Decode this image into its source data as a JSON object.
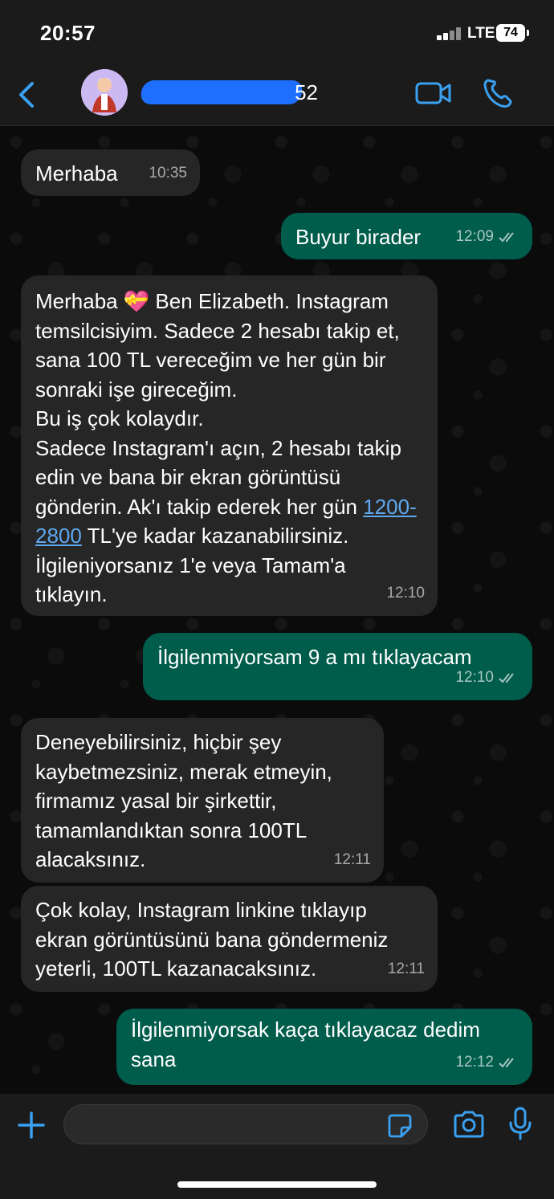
{
  "status_bar": {
    "time": "20:57",
    "network": "LTE",
    "battery": "74"
  },
  "header": {
    "contact_name_visible": "52"
  },
  "messages": [
    {
      "dir": "in",
      "text": "Merhaba",
      "time": "10:35"
    },
    {
      "dir": "out",
      "text": "Buyur birader",
      "time": "12:09"
    },
    {
      "dir": "in",
      "text_before_link": "Merhaba 💝 Ben Elizabeth. Instagram temsilcisiyim. Sadece 2 hesabı takip et, sana 100 TL vereceğim ve her gün bir sonraki işe gireceğim.\nBu iş çok kolaydır.\nSadece Instagram'ı açın, 2 hesabı takip edin ve bana bir ekran görüntüsü gönderin. Ak'ı takip ederek her gün ",
      "link": "1200-2800",
      "text_after_link": " TL'ye kadar kazanabilirsiniz. İlgileniyorsanız 1'e veya Tamam'a tıklayın.",
      "time": "12:10"
    },
    {
      "dir": "out",
      "text": "İlgilenmiyorsam 9 a mı tıklayacam",
      "time": "12:10"
    },
    {
      "dir": "in",
      "text": "Deneyebilirsiniz, hiçbir şey kaybetmezsiniz, merak etmeyin, firmamız yasal bir şirkettir, tamamlandıktan sonra 100TL alacaksınız.",
      "time": "12:11"
    },
    {
      "dir": "in",
      "text": "Çok kolay, Instagram linkine tıklayıp ekran görüntüsünü bana göndermeniz yeterli, 100TL kazanacaksınız.",
      "time": "12:11"
    },
    {
      "dir": "out",
      "text": "İlgilenmiyorsak kaça tıklayacaz dedim sana",
      "time": "12:12"
    }
  ],
  "input": {
    "placeholder": ""
  },
  "colors": {
    "incoming": "#262626",
    "outgoing": "#005c4b",
    "accent": "#3aa0f0",
    "link": "#5fa8f0"
  }
}
